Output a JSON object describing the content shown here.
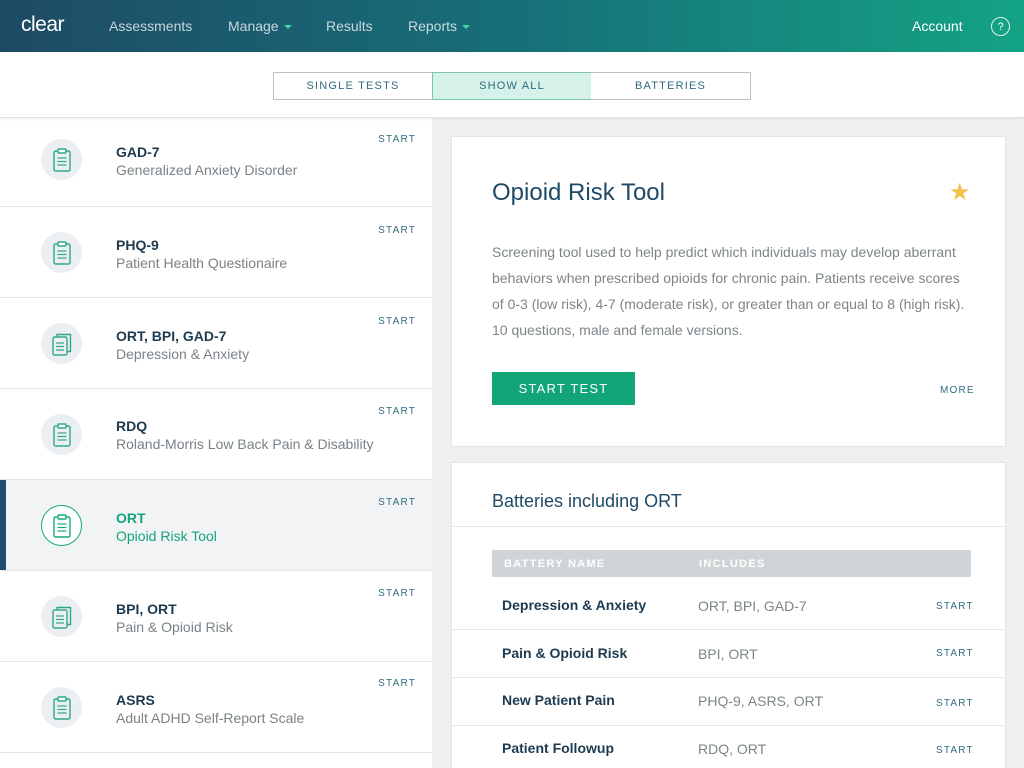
{
  "nav": {
    "logo": "clear",
    "items": [
      {
        "label": "Assessments",
        "dropdown": false
      },
      {
        "label": "Manage",
        "dropdown": true
      },
      {
        "label": "Results",
        "dropdown": false
      },
      {
        "label": "Reports",
        "dropdown": true
      }
    ],
    "account": "Account",
    "help": "?"
  },
  "filter": {
    "tabs": [
      {
        "label": "SINGLE TESTS",
        "active": false
      },
      {
        "label": "SHOW ALL",
        "active": true
      },
      {
        "label": "BATTERIES",
        "active": false
      }
    ]
  },
  "tests": [
    {
      "title": "GAD-7",
      "subtitle": "Generalized Anxiety Disorder",
      "action": "START",
      "icon": "clipboard-icon",
      "selected": false
    },
    {
      "title": "PHQ-9",
      "subtitle": "Patient Health Questionaire",
      "action": "START",
      "icon": "clipboard-icon",
      "selected": false
    },
    {
      "title": "ORT, BPI, GAD-7",
      "subtitle": "Depression & Anxiety",
      "action": "START",
      "icon": "stacked-clipboards-icon",
      "selected": false
    },
    {
      "title": "RDQ",
      "subtitle": "Roland-Morris Low Back Pain & Disability",
      "action": "START",
      "icon": "clipboard-icon",
      "selected": false
    },
    {
      "title": "ORT",
      "subtitle": "Opioid Risk Tool",
      "action": "START",
      "icon": "clipboard-icon",
      "selected": true
    },
    {
      "title": "BPI, ORT",
      "subtitle": "Pain & Opioid Risk",
      "action": "START",
      "icon": "stacked-clipboards-icon",
      "selected": false
    },
    {
      "title": "ASRS",
      "subtitle": "Adult ADHD Self-Report Scale",
      "action": "START",
      "icon": "clipboard-icon",
      "selected": false
    }
  ],
  "detail": {
    "title": "Opioid Risk Tool",
    "favorited": true,
    "description": "Screening tool used to help predict which individuals may develop aberrant behaviors when prescribed opioids for chronic pain. Patients receive scores of 0-3 (low risk), 4-7 (moderate risk), or greater than or equal to 8 (high risk). 10 questions, male and female versions.",
    "start_button": "START TEST",
    "more_link": "MORE"
  },
  "batteries": {
    "title": "Batteries including ORT",
    "columns": [
      "BATTERY NAME",
      "INCLUDES"
    ],
    "rows": [
      {
        "name": "Depression & Anxiety",
        "includes": "ORT, BPI, GAD-7",
        "action": "START"
      },
      {
        "name": "Pain & Opioid Risk",
        "includes": "BPI, ORT",
        "action": "START"
      },
      {
        "name": "New Patient Pain",
        "includes": "PHQ-9, ASRS, ORT",
        "action": "START"
      },
      {
        "name": "Patient Followup",
        "includes": "RDQ, ORT",
        "action": "START"
      }
    ]
  },
  "colors": {
    "accent": "#12a578",
    "nav_gradient_start": "#1e4a66",
    "nav_gradient_end": "#14a384",
    "selected_bar": "#1d4f6e",
    "star": "#f0c24a"
  }
}
